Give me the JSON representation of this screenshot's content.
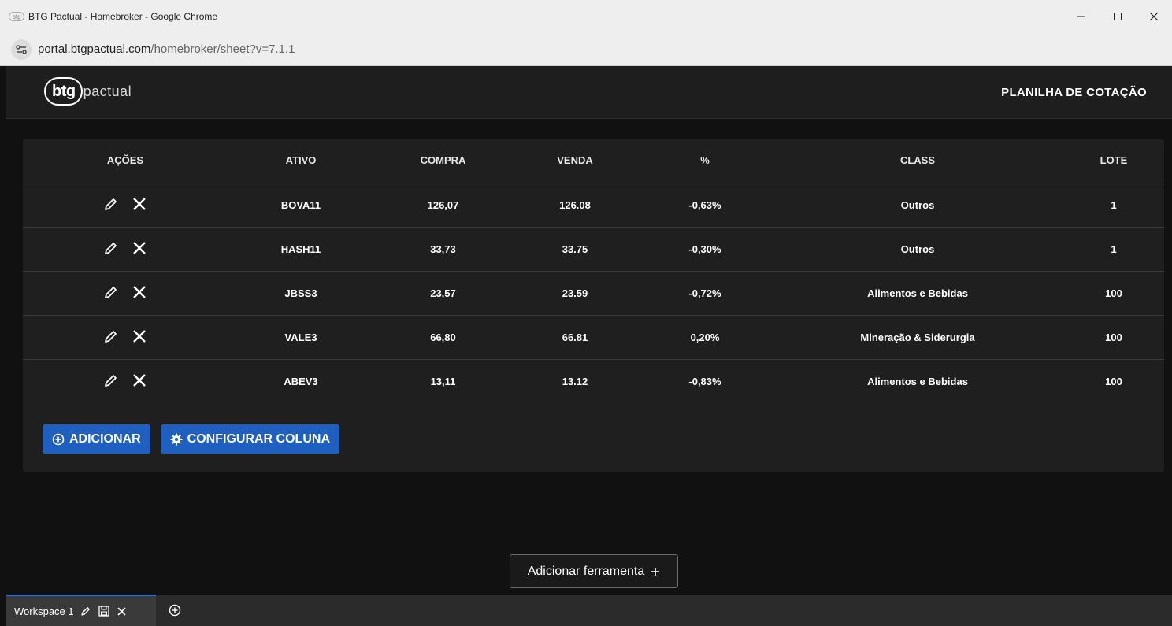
{
  "window": {
    "favicon_text": "btg",
    "title": "BTG Pactual - Homebroker - Google Chrome"
  },
  "address": {
    "host": "portal.btgpactual.com",
    "path": "/homebroker/sheet?v=7.1.1"
  },
  "header": {
    "logo_main": "btg",
    "logo_sub": "pactual",
    "page_title": "PLANILHA DE COTAÇÃO"
  },
  "table": {
    "columns": [
      "AÇÕES",
      "ATIVO",
      "COMPRA",
      "VENDA",
      "%",
      "CLASS",
      "LOTE"
    ],
    "rows": [
      {
        "ativo": "BOVA11",
        "compra": "126,07",
        "venda": "126.08",
        "pct": "-0,63%",
        "class": "Outros",
        "lote": "1"
      },
      {
        "ativo": "HASH11",
        "compra": "33,73",
        "venda": "33.75",
        "pct": "-0,30%",
        "class": "Outros",
        "lote": "1"
      },
      {
        "ativo": "JBSS3",
        "compra": "23,57",
        "venda": "23.59",
        "pct": "-0,72%",
        "class": "Alimentos e Bebidas",
        "lote": "100"
      },
      {
        "ativo": "VALE3",
        "compra": "66,80",
        "venda": "66.81",
        "pct": "0,20%",
        "class": "Mineração & Siderurgia",
        "lote": "100"
      },
      {
        "ativo": "ABEV3",
        "compra": "13,11",
        "venda": "13.12",
        "pct": "-0,83%",
        "class": "Alimentos e Bebidas",
        "lote": "100"
      }
    ]
  },
  "buttons": {
    "add_label": "ADICIONAR",
    "config_label": "CONFIGURAR COLUNA",
    "add_tool_label": "Adicionar ferramenta"
  },
  "workspace": {
    "tab_label": "Workspace 1"
  },
  "colors": {
    "accent": "#1f5fbf",
    "panel": "#1f1f1f",
    "background": "#111111"
  }
}
